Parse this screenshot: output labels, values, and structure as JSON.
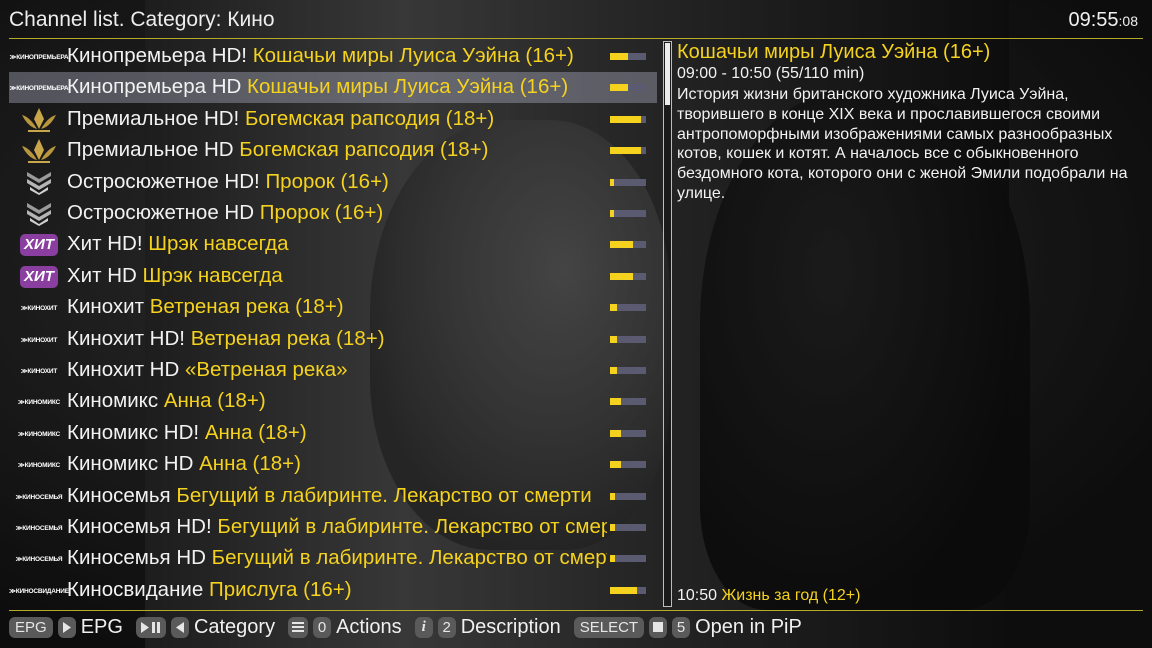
{
  "header": {
    "title": "Channel list. Category: Кино",
    "time_main": "09:55",
    "time_seconds": ":08"
  },
  "channels": [
    {
      "logo": "КИНОПРЕМЬЕРА",
      "logo_icon": "kinopremiera-logo",
      "name": "Кинопремьера HD!",
      "event": "Кошачьи миры Луиса Уэйна (16+)",
      "progress": 0.5,
      "selected": false
    },
    {
      "logo": "КИНОПРЕМЬЕРА",
      "logo_icon": "kinopremiera-logo",
      "name": "Кинопремьера HD",
      "event": "Кошачьи миры Луиса Уэйна (16+)",
      "progress": 0.5,
      "selected": true
    },
    {
      "logo": "",
      "logo_icon": "premialnoe-crown-logo",
      "name": "Премиальное HD!",
      "event": "Богемская рапсодия (18+)",
      "progress": 0.85,
      "selected": false
    },
    {
      "logo": "",
      "logo_icon": "premialnoe-crown-logo",
      "name": "Премиальное HD",
      "event": "Богемская рапсодия (18+)",
      "progress": 0.85,
      "selected": false
    },
    {
      "logo": "",
      "logo_icon": "ostrosyuzhetnoe-chevron-logo",
      "name": "Остросюжетное HD!",
      "event": "Пророк (16+)",
      "progress": 0.12,
      "selected": false
    },
    {
      "logo": "",
      "logo_icon": "ostrosyuzhetnoe-chevron-logo",
      "name": "Остросюжетное HD",
      "event": "Пророк (16+)",
      "progress": 0.12,
      "selected": false
    },
    {
      "logo": "ХИТ",
      "logo_icon": "hit-logo",
      "name": "Хит HD!",
      "event": "Шрэк навсегда",
      "progress": 0.65,
      "selected": false
    },
    {
      "logo": "ХИТ",
      "logo_icon": "hit-logo",
      "name": "Хит HD",
      "event": "Шрэк навсегда",
      "progress": 0.65,
      "selected": false
    },
    {
      "logo": "КИНОХИТ",
      "logo_icon": "kinohit-logo",
      "name": "Кинохит",
      "event": "Ветреная река (18+)",
      "progress": 0.2,
      "selected": false
    },
    {
      "logo": "КИНОХИТ",
      "logo_icon": "kinohit-logo",
      "name": "Кинохит HD!",
      "event": "Ветреная река (18+)",
      "progress": 0.2,
      "selected": false
    },
    {
      "logo": "КИНОХИТ",
      "logo_icon": "kinohit-logo",
      "name": "Кинохит HD",
      "event": "«Ветреная река»",
      "progress": 0.2,
      "selected": false
    },
    {
      "logo": "КИНОМИКС",
      "logo_icon": "kinomiks-logo",
      "name": "Киномикс",
      "event": "Анна (18+)",
      "progress": 0.3,
      "selected": false
    },
    {
      "logo": "КИНОМИКС",
      "logo_icon": "kinomiks-logo",
      "name": "Киномикс HD!",
      "event": "Анна (18+)",
      "progress": 0.3,
      "selected": false
    },
    {
      "logo": "КИНОМИКС",
      "logo_icon": "kinomiks-logo",
      "name": "Киномикс HD",
      "event": "Анна (18+)",
      "progress": 0.3,
      "selected": false
    },
    {
      "logo": "КИНОСЕМЬЯ",
      "logo_icon": "kinosemya-logo",
      "name": "Киносемья",
      "event": "Бегущий в лабиринте. Лекарство от смерти",
      "progress": 0.15,
      "selected": false
    },
    {
      "logo": "КИНОСЕМЬЯ",
      "logo_icon": "kinosemya-logo",
      "name": "Киносемья HD!",
      "event": "Бегущий в лабиринте. Лекарство от смерти",
      "progress": 0.15,
      "selected": false
    },
    {
      "logo": "КИНОСЕМЬЯ",
      "logo_icon": "kinosemya-logo",
      "name": "Киносемья HD",
      "event": "Бегущий в лабиринте. Лекарство от смерти",
      "progress": 0.15,
      "selected": false
    },
    {
      "logo": "КИНОСВИДАНИЕ",
      "logo_icon": "kinosvidanie-logo",
      "name": "Киносвидание",
      "event": "Прислуга (16+)",
      "progress": 0.75,
      "selected": false
    }
  ],
  "scrollbar": {
    "position": 0.0,
    "visible_fraction": 0.11
  },
  "info": {
    "event_title": "Кошачьи миры Луиса Уэйна (16+)",
    "event_time": "09:00 - 10:50 (55/110 min)",
    "description": "История жизни британского художника Луиса Уэйна, творившего в конце XIX века и прославившегося своими антропоморфными изображениями самых разнообразных котов, кошек и котят. А началось все с обыкновенного бездомного кота, которого они с женой Эмили подобрали на улице.",
    "next_time": "10:50",
    "next_event": "Жизнь за год (12+)"
  },
  "footer": {
    "epg_key": "EPG",
    "play_key_icon": "play-icon",
    "epg_label": "EPG",
    "playpause_key_icon": "play-pause-icon",
    "prev_key_icon": "chevron-left-icon",
    "category_label": "Category",
    "menu_key_icon": "menu-icon",
    "actions_key": "0",
    "actions_label": "Actions",
    "info_key_icon": "info-icon",
    "description_key": "2",
    "description_label": "Description",
    "select_key": "SELECT",
    "stop_key_icon": "stop-icon",
    "pip_key": "5",
    "pip_label": "Open in PiP"
  },
  "colors": {
    "accent": "#f5d21d",
    "divider": "#b7a92a",
    "selected_row": "#8c8c9a",
    "progress_track": "#5a5a70"
  }
}
